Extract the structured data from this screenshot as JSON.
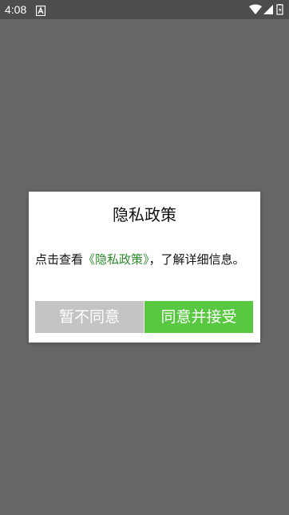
{
  "status_bar": {
    "time": "4:08",
    "icons": [
      "a-notification-icon",
      "wifi-icon",
      "signal-icon",
      "battery-icon"
    ]
  },
  "dialog": {
    "title": "隐私政策",
    "message_prefix": "点击查看",
    "policy_link": "《隐私政策》",
    "message_suffix": "，了解详细信息。",
    "decline_button": "暂不同意",
    "accept_button": "同意并接受"
  },
  "colors": {
    "overlay": "#666666",
    "link": "#2e8b2e",
    "decline_bg": "#c4c4c4",
    "accept_bg": "#58c840"
  }
}
